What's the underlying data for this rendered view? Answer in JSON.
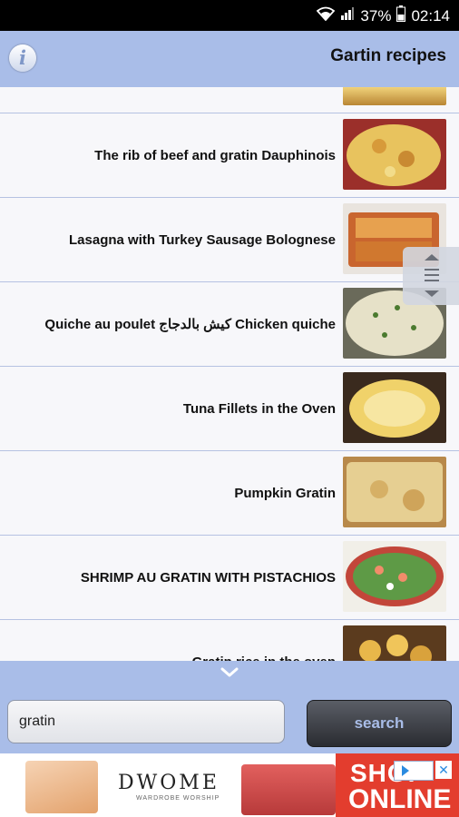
{
  "status_bar": {
    "battery": "37%",
    "time": "02:14"
  },
  "app_bar": {
    "title": "Gartin recipes",
    "info_icon": "info-icon"
  },
  "recipes": [
    {
      "title": "The rib of beef and gratin Dauphinois"
    },
    {
      "title": "Lasagna with Turkey Sausage Bolognese"
    },
    {
      "title": "Quiche au poulet كيش بالدجاج Chicken quiche"
    },
    {
      "title": "Tuna Fillets in the Oven"
    },
    {
      "title": "Pumpkin Gratin"
    },
    {
      "title": "SHRIMP AU GRATIN WITH PISTACHIOS"
    },
    {
      "title": "Gratin rice in the oven"
    }
  ],
  "search": {
    "value": "gratin",
    "button_label": "search"
  },
  "ad": {
    "brand": "DWOME",
    "tagline": "WARDROBE WORSHIP",
    "shop_line1": "SHOP",
    "shop_line2": "ONLINE"
  },
  "colors": {
    "accent": "#a9bde8",
    "row_divider": "#b6c2e2",
    "search_button": "#2a2c31"
  }
}
